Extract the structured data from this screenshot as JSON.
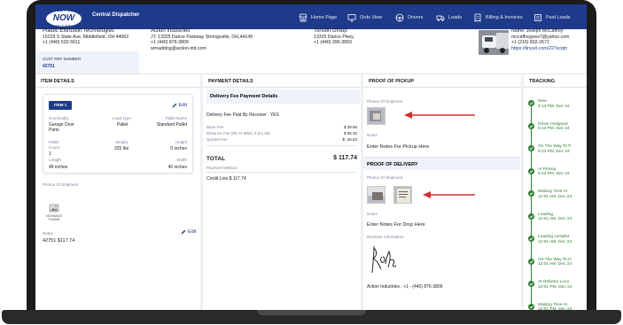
{
  "nav": {
    "logo_top": "ALL PRO",
    "logo_main": "NOW",
    "logo_bottom": "DELIVERY",
    "title": "Central Dispatcher",
    "items": [
      {
        "label": "Home Page",
        "icon": "storefront-icon"
      },
      {
        "label": "Ords View",
        "icon": "monitor-icon"
      },
      {
        "label": "Drivers",
        "icon": "steering-wheel-icon"
      },
      {
        "label": "Loads",
        "icon": "truck-icon"
      },
      {
        "label": "Billing & Invoices",
        "icon": "invoice-icon"
      },
      {
        "label": "Past Loads",
        "icon": "list-icon"
      }
    ]
  },
  "shipper": {
    "name": "Plastic Extrusion Technologies",
    "address": "15229 S State Ave, Middlefield, OH 44062",
    "phone": "+1 (440) 632-5611"
  },
  "receiver": {
    "name": "Action Industries",
    "address": "JT, 13325 Darice Parkway Strongsville, OH,44149",
    "phone": "+1 (440) 876-3809",
    "email": "wmadding@action-ind.com"
  },
  "broker": {
    "name": "Torsion Group",
    "address": "13325 Darice Pkwy,",
    "phone": "+1 (440) 396-3893"
  },
  "driver": {
    "name": "Name: Joseph McCaffrey",
    "email": "mccaffreyjoes7@yahoo.com",
    "phone": "+1 (216) 832-2671",
    "link": "https://tinyurl.com/227scqtn"
  },
  "cust_ref": {
    "label": "CUST REF NUMBER",
    "value": "42751"
  },
  "item_details": {
    "heading": "ITEM DETAILS",
    "badge": "ITEM 1",
    "edit": "Edit",
    "commodity_label": "Commodity",
    "commodity": "Garage Door Parts",
    "load_type_label": "Load Type",
    "load_type": "Pallet",
    "pallet_name_label": "Pallet Name",
    "pallet_name": "Standard Pallet",
    "pallet_count_label": "Pallet Count",
    "pallet_count": "1",
    "weight_label": "Weight",
    "weight": "325 lbs",
    "height_label": "Height",
    "height": "0 inches",
    "length_label": "Length",
    "length": "48 inches",
    "width_label": "Width",
    "width": "40 inches",
    "photos_label": "Photos Of Shipment",
    "no_image": "NO IMAGE FOUND",
    "notes_label": "Notes",
    "notes": "42751 $117.74",
    "edit2": "Edit"
  },
  "payment": {
    "heading": "PAYMENT DETAILS",
    "title": "Delivery Fee Payment Details",
    "paid_by": "Delivery Fee Paid By Receiver : YES",
    "base_fee_label": "Base Fee",
    "base_fee": "$ 38.95",
    "distance_fee_label": "Distance Fee (56.74 Miles X $ 1.68)",
    "distance_fee": "$ 95.32",
    "quoted_fee_label": "Quoted Fee",
    "quoted_fee": "$ -16.53",
    "total_label": "TOTAL",
    "total": "$ 117.74",
    "method_label": "Payment Method",
    "method": "Credit Line:$ 117.74"
  },
  "pickup": {
    "heading": "PROOF OF PICKUP",
    "photos_label": "Photos Of Shipment",
    "notes_label": "Notes",
    "notes": "Enter Notes For Pickup Here"
  },
  "delivery": {
    "heading": "PROOF OF DELIVERY",
    "photos_label": "Photos Of Shipment",
    "notes_label": "Notes",
    "notes": "Enter Notes For Drop Here",
    "receiver_label": "Receiver Information",
    "signed_by": "Action Industries , +1 - (440) 876-3809"
  },
  "tracking": {
    "heading": "TRACKING",
    "events": [
      {
        "status": "New",
        "time": "9:13 PM, Dec 24"
      },
      {
        "status": "Driver Assigned",
        "time": "9:13 PM, Dec 24"
      },
      {
        "status": "On The Way To P",
        "time": "9:13 PM, Dec 24"
      },
      {
        "status": "At Pickup",
        "time": "9:14 PM, Dec 24"
      },
      {
        "status": "Waiting Time At",
        "time": "12:01 AM, Dec 24"
      },
      {
        "status": "Loading",
        "time": "12:01 AM, Dec 24"
      },
      {
        "status": "Loading complet",
        "time": "12:01 AM, Dec 24"
      },
      {
        "status": "On The Way To D",
        "time": "12:01 AM, Dec 24"
      },
      {
        "status": "At Delivery Loca",
        "time": "12:01 PM, Dec 24"
      },
      {
        "status": "Waiting Time At",
        "time": "12:01 PM, Dec 24"
      }
    ]
  },
  "colors": {
    "nav": "#1e3a8a",
    "accent": "#1e3a8a",
    "tracking": "#2e7d32",
    "arrow": "#d32f2f"
  }
}
